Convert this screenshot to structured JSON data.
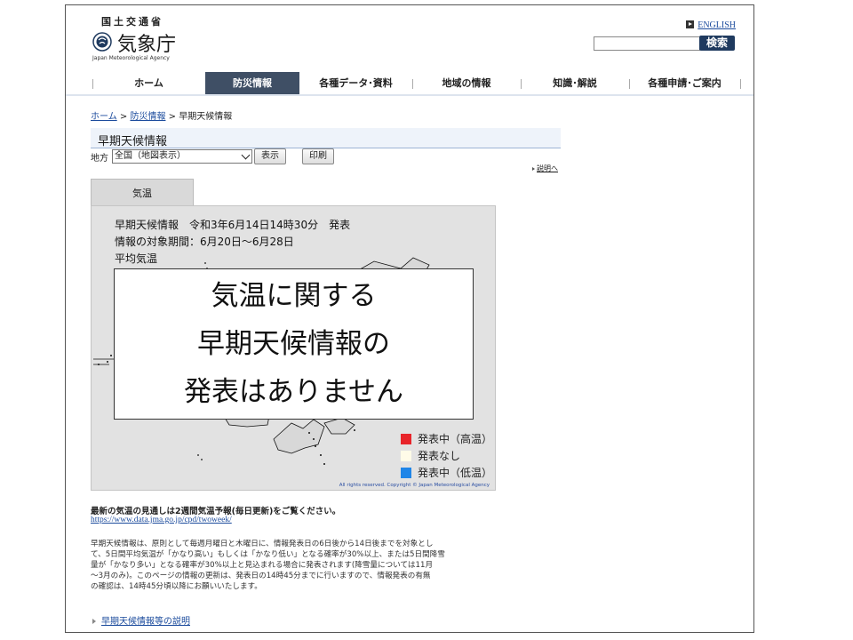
{
  "header": {
    "ministry": "国土交通省",
    "agency_name": "気象庁",
    "agency_name_en": "Japan Meteorological Agency",
    "english_link": "ENGLISH",
    "search_placeholder": "",
    "search_button": "検索"
  },
  "nav": {
    "items": [
      {
        "label": "ホーム",
        "active": false
      },
      {
        "label": "防災情報",
        "active": true
      },
      {
        "label": "各種データ･資料",
        "active": false
      },
      {
        "label": "地域の情報",
        "active": false
      },
      {
        "label": "知識･解説",
        "active": false
      },
      {
        "label": "各種申請･ご案内",
        "active": false
      }
    ]
  },
  "breadcrumb": {
    "home": "ホーム",
    "sep1": " > ",
    "section": "防災情報",
    "sep2": " > ",
    "current": "早期天候情報"
  },
  "page": {
    "title": "早期天候情報",
    "region_label": "地方",
    "region_selected": "全国（地図表示）",
    "show_button": "表示",
    "print_button": "印刷",
    "explain_link": "説明へ"
  },
  "tabs": [
    {
      "label": "気温",
      "active": true
    }
  ],
  "panel": {
    "line1": "早期天候情報　令和3年6月14日14時30分　発表",
    "line2": "情報の対象期間：6月20日～6月28日",
    "line3": "平均気温",
    "overlay": [
      "気温に関する",
      "早期天候情報の",
      "発表はありません"
    ],
    "legend": [
      {
        "label": "発表中（高温）",
        "color": "#e8242a"
      },
      {
        "label": "発表なし",
        "color": "#fffbe8"
      },
      {
        "label": "発表中（低温）",
        "color": "#1f86e8"
      }
    ],
    "copyright": "All rights reserved. Copyright © Japan Meteorological Agency"
  },
  "notes": {
    "strong": "最新の気温の見通しは2週間気温予報(毎日更新)をご覧ください。",
    "link": "https://www.data.jma.go.jp/cpd/twoweek/",
    "desc": [
      "早期天候情報は、原則として毎週月曜日と木曜日に、情報発表日の6日後から14日後までを対象とし",
      "て、5日間平均気温が「かなり高い」もしくは「かなり低い」となる確率が30%以上、または5日間降雪",
      "量が「かなり多い」となる確率が30%以上と見込まれる場合に発表されます(降雪量については11月",
      "～3月のみ)。このページの情報の更新は、発表日の14時45分までに行いますので、情報発表の有無",
      "の確認は、14時45分頃以降にお願いいたします。"
    ],
    "bottom_link": "早期天候情報等の説明"
  }
}
